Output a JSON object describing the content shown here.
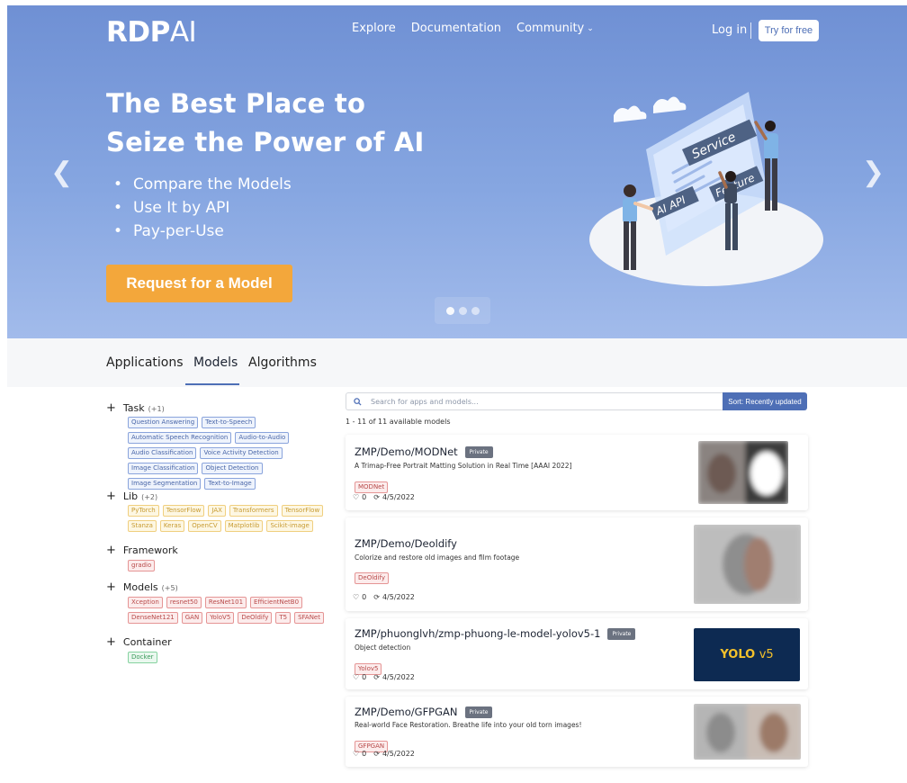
{
  "brand": {
    "logo_bold": "RDP",
    "logo_light": "AI"
  },
  "nav": {
    "explore": "Explore",
    "documentation": "Documentation",
    "community": "Community",
    "login": "Log in",
    "try_free": "Try for free"
  },
  "hero": {
    "title_line1": "The Best Place to",
    "title_line2": "Seize the Power of AI",
    "bullets": [
      "Compare the Models",
      "Use It by API",
      "Pay-per-Use"
    ],
    "cta": "Request for a Model",
    "illustration_labels": {
      "service": "Service",
      "ai_api": "AI API",
      "feature": "Feature"
    },
    "carousel_active_index": 0
  },
  "tabs": {
    "applications": "Applications",
    "models": "Models",
    "algorithms": "Algorithms",
    "active": "Models"
  },
  "filters": {
    "task": {
      "label": "Task",
      "count": "(+1)",
      "tags": [
        "Question Answering",
        "Text-to-Speech",
        "Automatic Speech Recognition",
        "Audio-to-Audio",
        "Audio Classification",
        "Voice Activity Detection",
        "Image Classification",
        "Object Detection",
        "Image Segmentation",
        "Text-to-Image"
      ]
    },
    "lib": {
      "label": "Lib",
      "count": "(+2)",
      "tags": [
        "PyTorch",
        "TensorFlow",
        "JAX",
        "Transformers",
        "TensorFlow",
        "Stanza",
        "Keras",
        "OpenCV",
        "Matplotlib",
        "Scikit-image"
      ]
    },
    "framework": {
      "label": "Framework",
      "tags": [
        "gradio"
      ]
    },
    "models": {
      "label": "Models",
      "count": "(+5)",
      "tags": [
        "Xception",
        "resnet50",
        "ResNet101",
        "EfficientNetB0",
        "DenseNet121",
        "GAN",
        "YoloV5",
        "DeOldify",
        "T5",
        "SFANet"
      ]
    },
    "container": {
      "label": "Container",
      "tags": [
        "Docker"
      ]
    }
  },
  "search": {
    "placeholder": "Search for apps and models...",
    "sort_label": "Sort: Recently updated"
  },
  "results_count": "1 - 11 of 11 available models",
  "cards": [
    {
      "title": "ZMP/Demo/MODNet",
      "private": "Private",
      "description": "A Trimap-Free Portrait Matting Solution in Real Time [AAAI 2022]",
      "tag": "MODNet",
      "likes": "0",
      "updated": "4/5/2022"
    },
    {
      "title": "ZMP/Demo/Deoldify",
      "description": "Colorize and restore old images and film footage",
      "tag": "DeOldify",
      "likes": "0",
      "updated": "4/5/2022"
    },
    {
      "title": "ZMP/phuonglvh/zmp-phuong-le-model-yolov5-1",
      "private": "Private",
      "description": "Object detection",
      "tag": "Yolov5",
      "likes": "0",
      "updated": "4/5/2022",
      "thumb_text_bold": "YOLO",
      "thumb_text_light": "v5"
    },
    {
      "title": "ZMP/Demo/GFPGAN",
      "private": "Private",
      "description": "Real-world Face Restoration. Breathe life into your old torn images!",
      "tag": "GFPGAN",
      "likes": "0",
      "updated": "4/5/2022"
    }
  ],
  "colors": {
    "accent": "#4e6fb6",
    "cta": "#f3a73b",
    "hero_top": "#6f90d4",
    "hero_bottom": "#a2bbeb"
  }
}
